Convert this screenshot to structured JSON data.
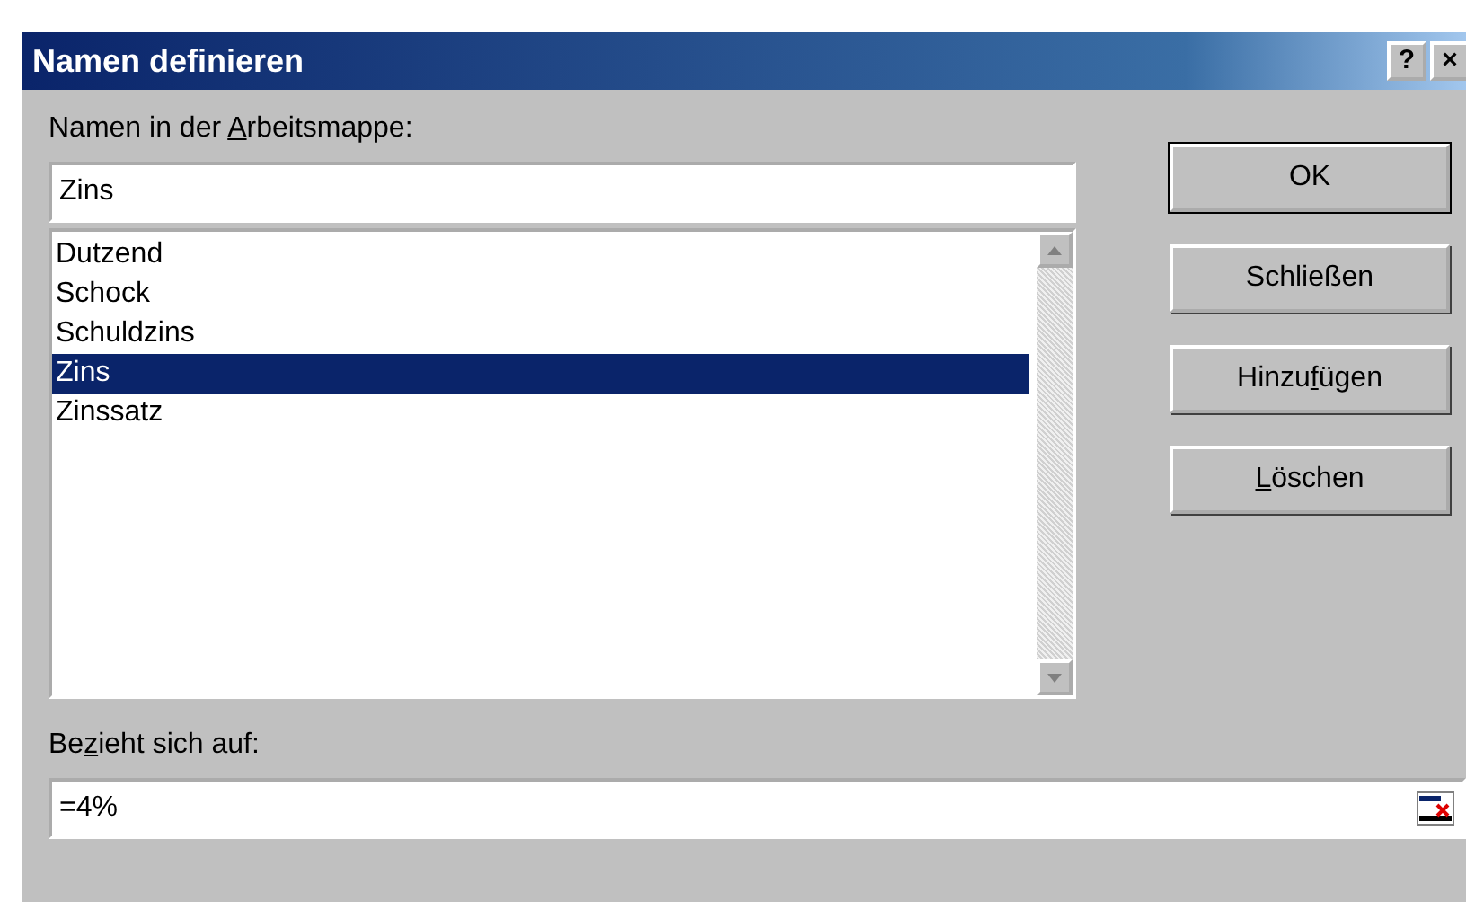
{
  "window": {
    "title": "Namen definieren",
    "title_buttons": [
      "?",
      "×"
    ]
  },
  "names_label": {
    "before": "Namen in der ",
    "key": "A",
    "after": "rbeitsmappe:"
  },
  "name_field": {
    "value": "Zins"
  },
  "names_list": [
    {
      "label": "Dutzend",
      "selected": false
    },
    {
      "label": "Schock",
      "selected": false
    },
    {
      "label": "Schuldzins",
      "selected": false
    },
    {
      "label": "Zins",
      "selected": true
    },
    {
      "label": "Zinssatz",
      "selected": false
    }
  ],
  "buttons": [
    {
      "before": "OK",
      "default": true
    },
    {
      "before": "Schließen",
      "default": false
    },
    {
      "before": "Hinzu",
      "key": "f",
      "after": "ügen",
      "default": false
    },
    {
      "key": "L",
      "after": "öschen",
      "default": false
    }
  ],
  "refers_label": {
    "before": "Be",
    "key": "z",
    "after": "ieht sich auf:"
  },
  "refers_field": {
    "value": "=4%"
  }
}
